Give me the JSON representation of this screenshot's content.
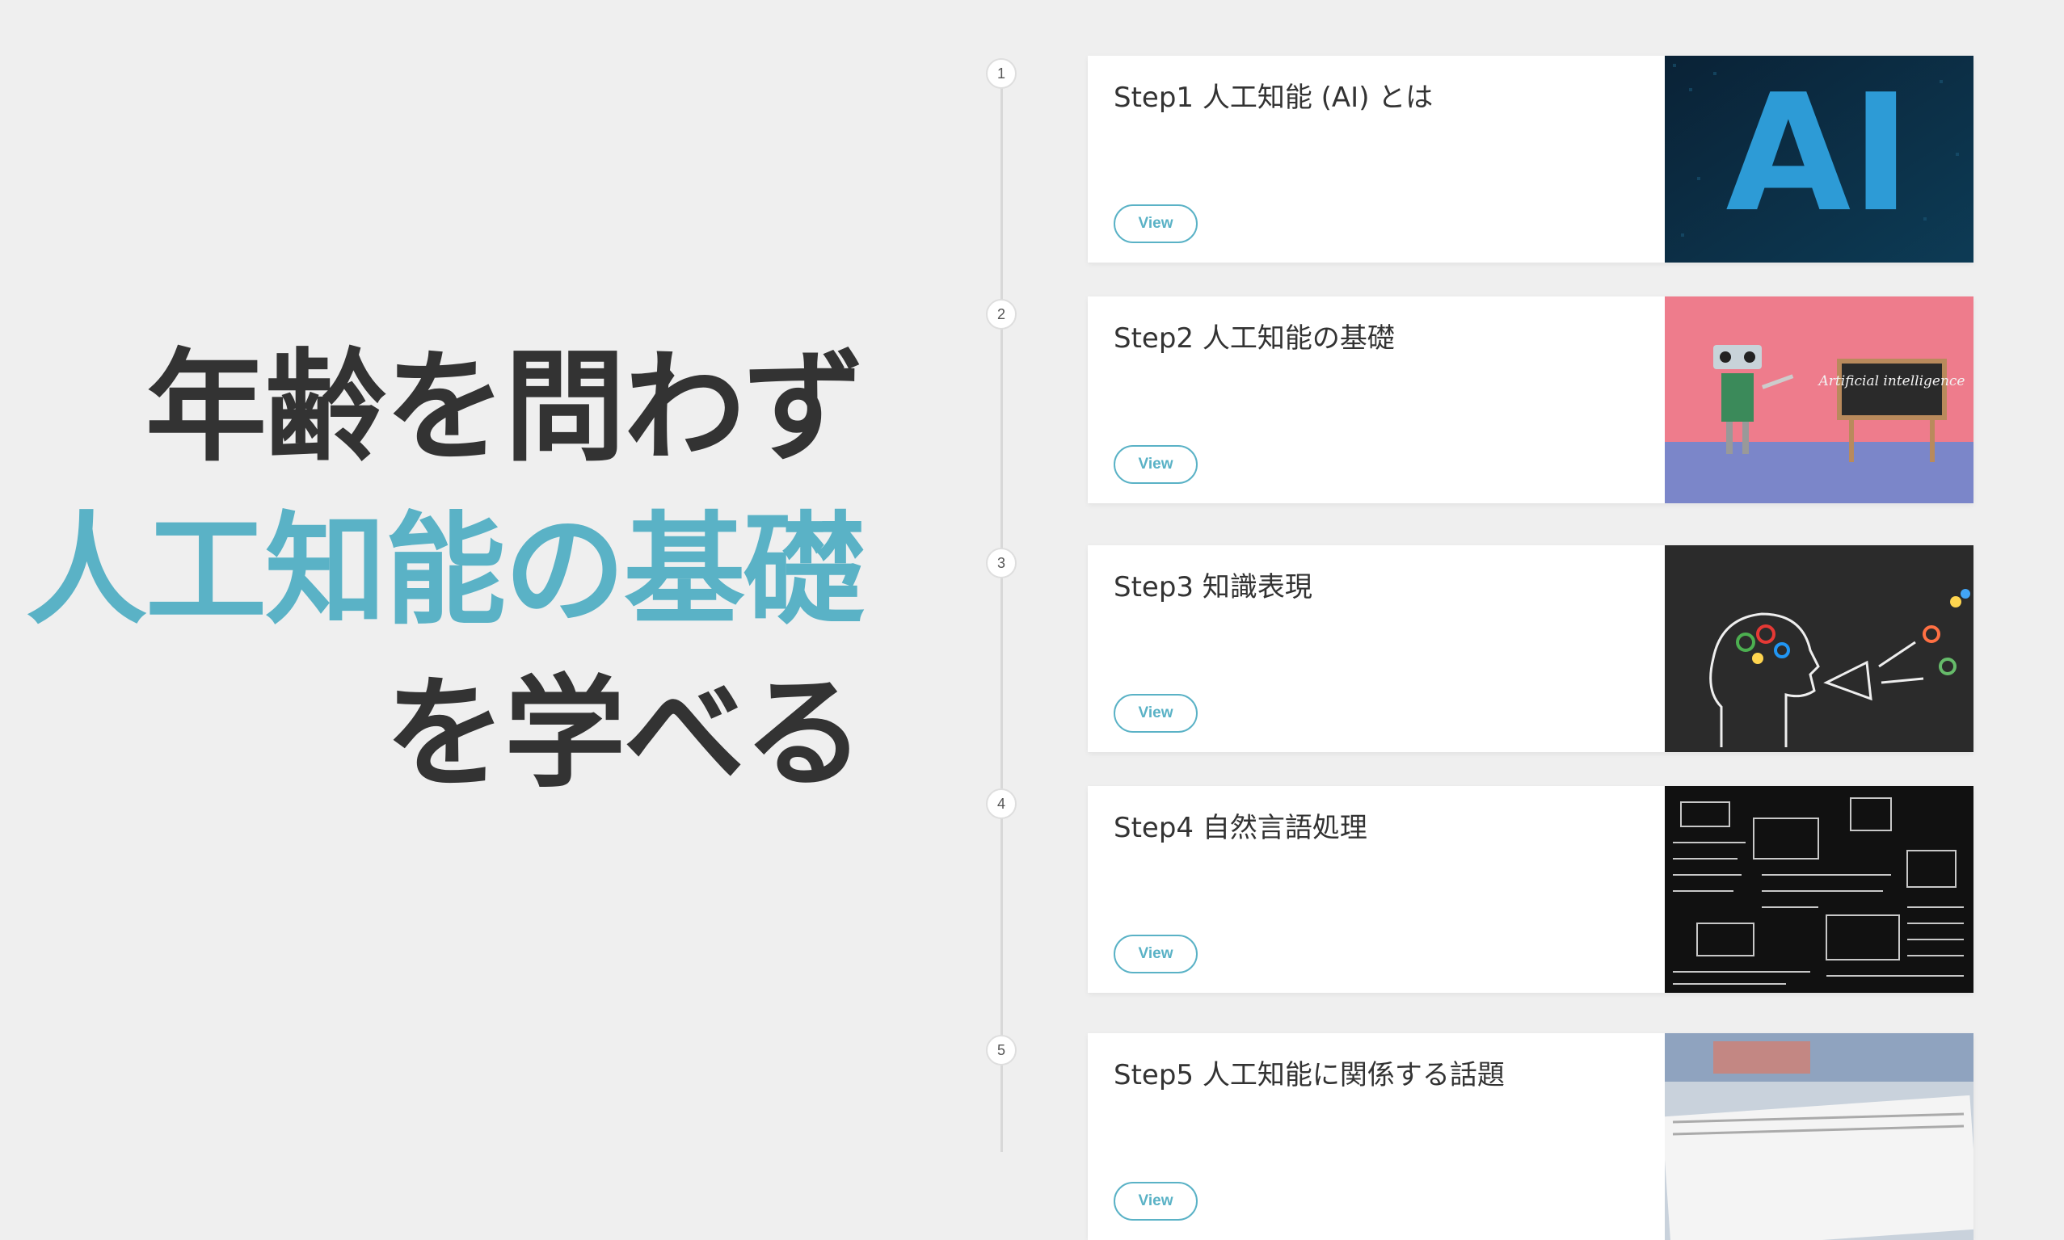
{
  "hero": {
    "line1": "年齢を問わず",
    "line2": "人工知能の基礎",
    "line3": "を学べる"
  },
  "steps": [
    {
      "number": "1",
      "title": "Step1 人工知能 (AI) とは",
      "button": "View",
      "thumb_icon": "ai-text-image",
      "thumb_text": "AI"
    },
    {
      "number": "2",
      "title": "Step2 人工知能の基礎",
      "button": "View",
      "thumb_icon": "robot-chalkboard-image",
      "thumb_text": "Artificial intelligence"
    },
    {
      "number": "3",
      "title": "Step3 知識表現",
      "button": "View",
      "thumb_icon": "head-megaphone-chalk-image"
    },
    {
      "number": "4",
      "title": "Step4 自然言語処理",
      "button": "View",
      "thumb_icon": "chalkboard-code-image"
    },
    {
      "number": "5",
      "title": "Step5 人工知能に関係する話題",
      "button": "View",
      "thumb_icon": "newspaper-image"
    }
  ],
  "colors": {
    "accent": "#5ab2c6",
    "text_dark": "#333333",
    "background": "#efefef"
  }
}
